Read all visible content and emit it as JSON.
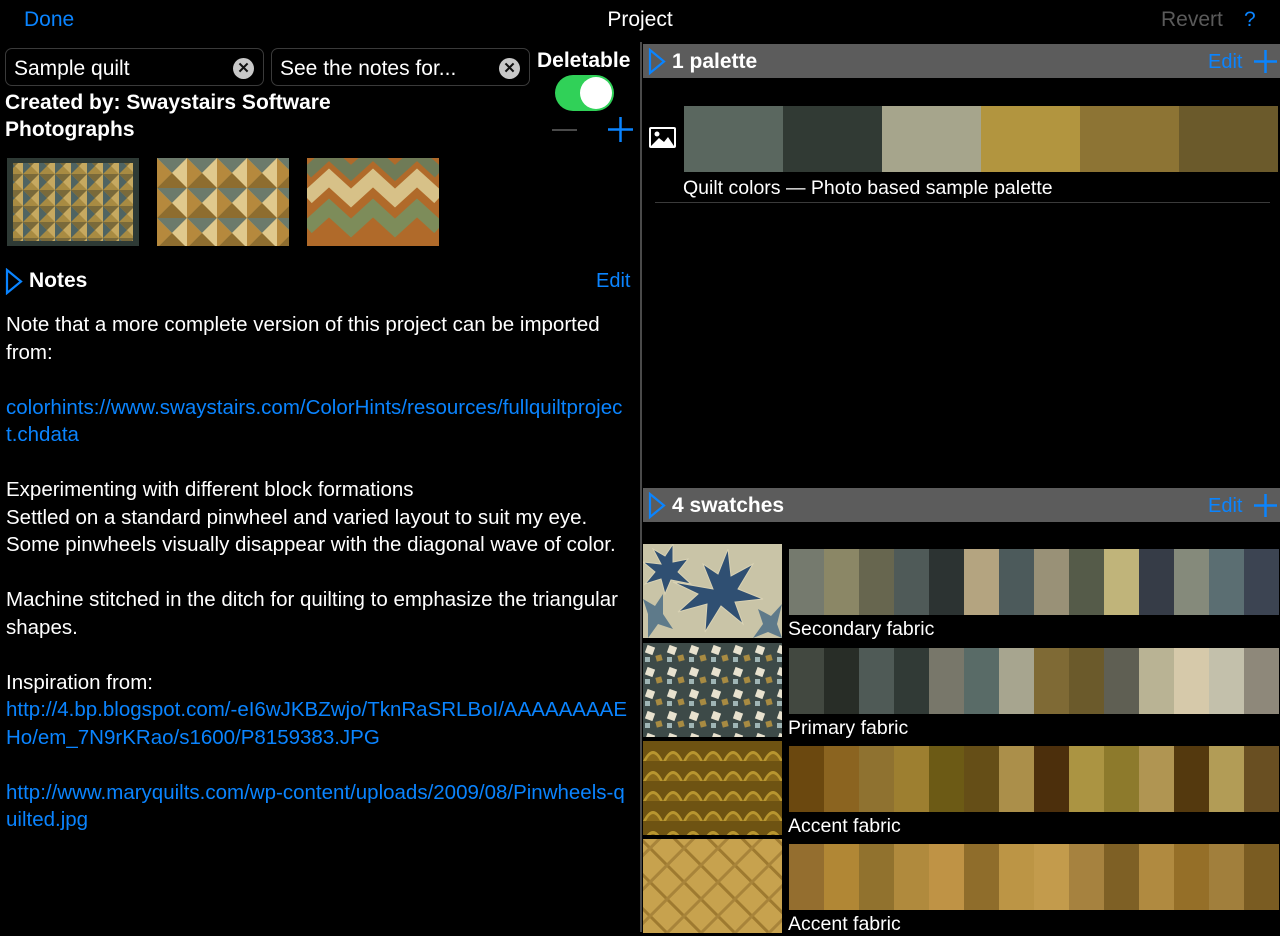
{
  "nav": {
    "done": "Done",
    "title": "Project",
    "revert": "Revert",
    "help": "?"
  },
  "project": {
    "name_value": "Sample quilt",
    "description_value": "See the notes for...",
    "deletable_label": "Deletable",
    "deletable_on": true,
    "created_by": "Created by: Swaystairs Software",
    "photographs_label": "Photographs"
  },
  "notes": {
    "header": "Notes",
    "edit": "Edit",
    "intro": "Note that a more complete version of this project can be imported from:",
    "link1": "colorhints://www.swaystairs.com/ColorHints/resources/fullquiltproject.chdata",
    "para1_line1": "Experimenting with different block formations",
    "para1_line2": "Settled on a standard pinwheel and varied layout to suit my eye. Some pinwheels visually disappear with the diagonal wave of color.",
    "para2": "Machine stitched in the ditch for quilting to emphasize the triangular shapes.",
    "inspiration_label": "Inspiration from:",
    "link2": "http://4.bp.blogspot.com/-eI6wJKBZwjo/TknRaSRLBoI/AAAAAAAAEHo/em_7N9rKRao/s1600/P8159383.JPG",
    "link3": "http://www.maryquilts.com/wp-content/uploads/2009/08/Pinwheels-quilted.jpg"
  },
  "palettes": {
    "header": "1 palette",
    "edit": "Edit",
    "items": [
      {
        "label": "Quilt colors — Photo based sample palette",
        "colors": [
          "#5a675f",
          "#313a34",
          "#a6a58c",
          "#b2953f",
          "#8d7434",
          "#6b5a2b"
        ]
      }
    ]
  },
  "swatches": {
    "header": "4 swatches",
    "edit": "Edit",
    "items": [
      {
        "label": "Secondary fabric",
        "colors": [
          "#757a6e",
          "#8b8766",
          "#67664f",
          "#4f5a58",
          "#2c3332",
          "#b4a480",
          "#4c5a5b",
          "#999177",
          "#555b49",
          "#c0b47a",
          "#363c47",
          "#858a7b",
          "#5b6e72",
          "#3c4452"
        ]
      },
      {
        "label": "Primary fabric",
        "colors": [
          "#424840",
          "#282d27",
          "#4f5a56",
          "#313a36",
          "#78776a",
          "#596b67",
          "#a7a58f",
          "#7f6a35",
          "#6b5a2b",
          "#5f5f53",
          "#b9b394",
          "#d6c9aa",
          "#c3c0ab",
          "#8e887a"
        ]
      },
      {
        "label": "Accent fabric",
        "colors": [
          "#6b480f",
          "#8b6420",
          "#8f7230",
          "#9d7f30",
          "#6c5a15",
          "#654e17",
          "#ab8f4a",
          "#4c2f0c",
          "#ab9442",
          "#8d7a2c",
          "#b09552",
          "#54390e",
          "#b29c56",
          "#694f22"
        ]
      },
      {
        "label": "Accent fabric",
        "colors": [
          "#946e2f",
          "#b18735",
          "#91722e",
          "#b08a3d",
          "#bf9345",
          "#8f6d2b",
          "#bc9545",
          "#c39b4c",
          "#a6823f",
          "#7e6025",
          "#b08a40",
          "#956f28",
          "#a17f3c",
          "#7a5c22"
        ]
      }
    ]
  }
}
